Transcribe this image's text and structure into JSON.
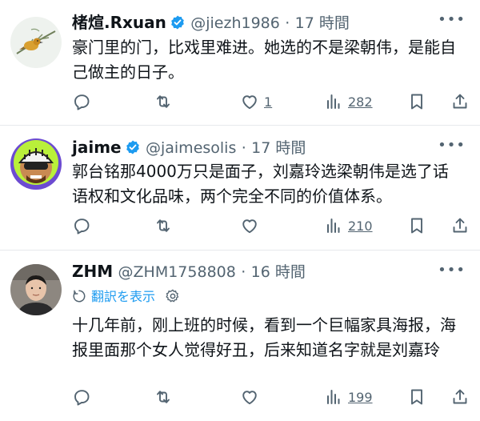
{
  "tweets": [
    {
      "name": "楮煊.Rxuan",
      "handle": "@jiezh1986",
      "dot": "·",
      "time": "17 時間",
      "text": "豪门里的门，比戏里难进。她选的不是梁朝伟，是能自己做主的日子。",
      "likes": "1",
      "views": "282",
      "verified": true
    },
    {
      "name": "jaime",
      "handle": "@jaimesolis",
      "dot": "·",
      "time": "17 時間",
      "text": "郭台铭那4000万只是面子，刘嘉玲选梁朝伟是选了话语权和文化品味，两个完全不同的价值体系。",
      "likes": "",
      "views": "210",
      "verified": true
    },
    {
      "name": "ZHM",
      "handle": "@ZHM1758808",
      "dot": "·",
      "time": "16 時間",
      "translate_label": "翻訳を表示",
      "text": "十几年前，刚上班的时候，看到一个巨幅家具海报，海报里面那个女人觉得好丑，后来知道名字就是刘嘉玲",
      "likes": "",
      "views": "199",
      "verified": false
    }
  ],
  "icons": {
    "reply": "reply-icon",
    "retweet": "retweet-icon",
    "like": "heart-icon",
    "views": "views-icon",
    "bookmark": "bookmark-icon",
    "share": "share-icon",
    "more": "more-icon",
    "verified": "verified-badge-icon"
  },
  "colors": {
    "verified": "#1d9bf0",
    "link": "#1d9bf0",
    "muted": "#536471",
    "text": "#0f1419"
  }
}
